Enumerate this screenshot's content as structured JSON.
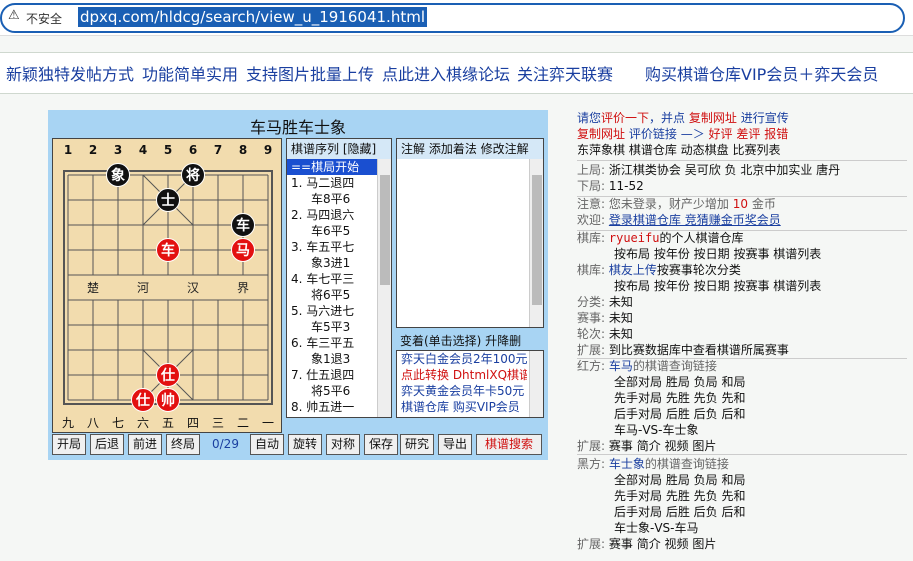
{
  "browser": {
    "security_label": "不安全",
    "url": "dpxq.com/hldcg/search/view_u_1916041.html"
  },
  "topnav": {
    "links": [
      "新颖独特发帖方式",
      "功能简单实用",
      "支持图片批量上传",
      "点此进入棋缘论坛",
      "关注弈天联赛",
      "购买棋谱仓库VIP会员＋弈天会员"
    ]
  },
  "game": {
    "title": "车马胜车士象",
    "col_numbers_top": [
      "1",
      "2",
      "3",
      "4",
      "5",
      "6",
      "7",
      "8",
      "9"
    ],
    "col_numbers_bottom": [
      "九",
      "八",
      "七",
      "六",
      "五",
      "四",
      "三",
      "二",
      "一"
    ],
    "river": [
      "楚",
      "河",
      "汉",
      "界"
    ],
    "pieces": [
      {
        "char": "象",
        "side": "black"
      },
      {
        "char": "将",
        "side": "black"
      },
      {
        "char": "士",
        "side": "black"
      },
      {
        "char": "车",
        "side": "black"
      },
      {
        "char": "车",
        "side": "red"
      },
      {
        "char": "马",
        "side": "red"
      },
      {
        "char": "仕",
        "side": "red"
      },
      {
        "char": "仕",
        "side": "red"
      },
      {
        "char": "帅",
        "side": "red"
      }
    ],
    "moves_header": "棋谱序列  [隐藏]",
    "moves": [
      "==棋局开始",
      "1. 马二退四",
      "车8平6",
      "2. 马四退六",
      "车6平5",
      "3. 车五平七",
      "象3进1",
      "4. 车七平三",
      "将6平5",
      "5. 马六进七",
      "车5平3",
      "6. 车三平五",
      "象1退3",
      "7. 仕五退四",
      "将5平6",
      "8. 帅五进一"
    ],
    "annot_header": "注解 添加着法 修改注解",
    "variation_header": "变着(单击选择)  升降删",
    "ads": [
      {
        "text": "弈天白金会员2年100元",
        "color": "#1a3fa0"
      },
      {
        "text": "点此转换 DhtmlXQ棋谱",
        "color": "#d01010"
      },
      {
        "text": "弈天黄金会员年卡50元",
        "color": "#1a3fa0"
      },
      {
        "text": "棋谱仓库 购买VIP会员",
        "color": "#1a3fa0"
      }
    ],
    "buttons": {
      "start": "开局",
      "back": "后退",
      "forward": "前进",
      "end": "终局",
      "counter": "0/29",
      "auto": "自动",
      "rotate": "旋转",
      "mirror": "对称",
      "save": "保存",
      "study": "研究",
      "export": "导出",
      "search": "棋谱搜索"
    }
  },
  "side": {
    "line1": {
      "a": "请您",
      "b": "评价一下",
      "c": "，并点",
      "d": "复制网址",
      "e": "进行宣传"
    },
    "line2": {
      "a": "复制网址",
      "b": "评价链接",
      "c": "—＞",
      "d": "好评",
      "e": "差评",
      "f": "报错"
    },
    "line3": "东萍象棋 棋谱仓库 动态棋盘 比赛列表",
    "upper": {
      "label": "上局:",
      "value": "浙江棋类协会 吴可欣 负 北京中加实业 唐丹"
    },
    "lower": {
      "label": "下局:",
      "value": "11-52"
    },
    "notice": {
      "label": "注意:",
      "pre": "您未登录，财产少增加",
      "num": "10",
      "post": "金币"
    },
    "welcome": {
      "label": "欢迎:",
      "value": "登录棋谱仓库 竞猜赚金币奖会员"
    },
    "lib1": {
      "label": "棋库:",
      "user": "ryueifu",
      "rest": "的个人棋谱仓库"
    },
    "lib1_links": "按布局 按年份 按日期 按赛事 棋谱列表",
    "lib2": {
      "label": "棋库:",
      "a": "棋友上传",
      "b": "按赛事轮次分类"
    },
    "lib2_links": "按布局 按年份 按日期 按赛事 棋谱列表",
    "category": {
      "label": "分类:",
      "value": "未知"
    },
    "event": {
      "label": "赛事:",
      "value": "未知"
    },
    "round": {
      "label": "轮次:",
      "value": "未知"
    },
    "ext1": {
      "label": "扩展:",
      "value": "到比赛数据库中查看棋谱所属赛事"
    },
    "red": {
      "label": "红方:",
      "name": "车马",
      "rest": "的棋谱查询链接"
    },
    "red_links": [
      "全部对局 胜局 负局 和局",
      "先手对局 先胜 先负 先和",
      "后手对局 后胜 后负 后和",
      "车马-VS-车士象"
    ],
    "ext2": {
      "label": "扩展:",
      "value": "赛事 简介 视频 图片"
    },
    "black": {
      "label": "黑方:",
      "name": "车士象",
      "rest": "的棋谱查询链接"
    },
    "black_links": [
      "全部对局 胜局 负局 和局",
      "先手对局 先胜 先负 先和",
      "后手对局 后胜 后负 后和",
      "车士象-VS-车马"
    ],
    "ext3": {
      "label": "扩展:",
      "value": "赛事 简介 视频 图片"
    }
  }
}
